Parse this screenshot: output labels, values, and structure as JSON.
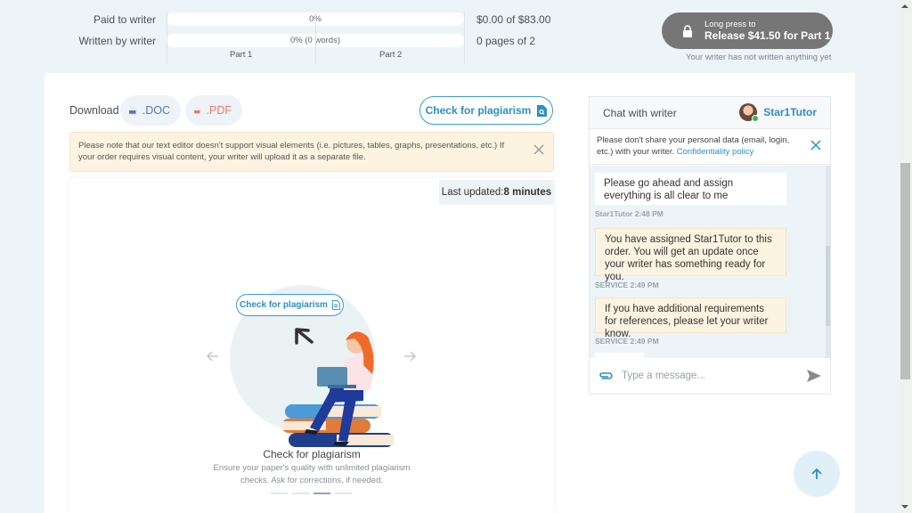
{
  "progress": {
    "paid": {
      "label": "Paid to writer",
      "percent_text": "0%",
      "percent": 0,
      "value": "$0.00 of $83.00"
    },
    "written": {
      "label": "Written by writer",
      "percent_text": "0% (0 words)",
      "percent": 0,
      "value": "0 pages of 2"
    },
    "parts": [
      "Part 1",
      "Part 2"
    ]
  },
  "release": {
    "line1": "Long press to",
    "line2": "Release $41.50 for Part 1",
    "note": "Your writer has not written anything yet",
    "icon": "lock-icon"
  },
  "download": {
    "label": "Download",
    "doc_label": ".DOC",
    "pdf_label": ".PDF"
  },
  "plagiarism_button": "Check for plagiarism",
  "notice": {
    "text": "Please note that our text editor doesn't support visual elements (i.e. pictures, tables, graphs, presentations, etc.) If your order requires visual content, your writer will upload it as a separate file."
  },
  "editor": {
    "last_updated_label": "Last updated:",
    "last_updated_value": "8 minutes"
  },
  "carousel": {
    "button_label": "Check for plagiarism",
    "title": "Check for plagiarism",
    "description": "Ensure your paper's quality with unlimited plagiarism checks. Ask for corrections, if needed.",
    "total_slides": 4,
    "active_slide": 3
  },
  "chat": {
    "title": "Chat with writer",
    "writer_name": "Star1Tutor",
    "privacy_text": "Please don't share your personal data (email, login, etc.) with your writer.",
    "privacy_link": "Confidentiality policy",
    "messages": [
      {
        "type": "writer",
        "text": "Please go ahead and assign everything is all clear to me",
        "meta": "Star1Tutor 2:48 PM"
      },
      {
        "type": "service",
        "text": "You have assigned Star1Tutor to this order. You will get an update once your writer has something ready for you.",
        "meta": "SERVICE 2:49 PM"
      },
      {
        "type": "service",
        "text": "If you have additional requirements for references, please let your writer know.",
        "meta": "SERVICE 2:49 PM"
      }
    ],
    "input_placeholder": "Type a message..."
  },
  "colors": {
    "accent": "#2a8fc7",
    "release_button": "#767676",
    "notice_bg": "#fdf3e1",
    "online": "#38b54a"
  }
}
